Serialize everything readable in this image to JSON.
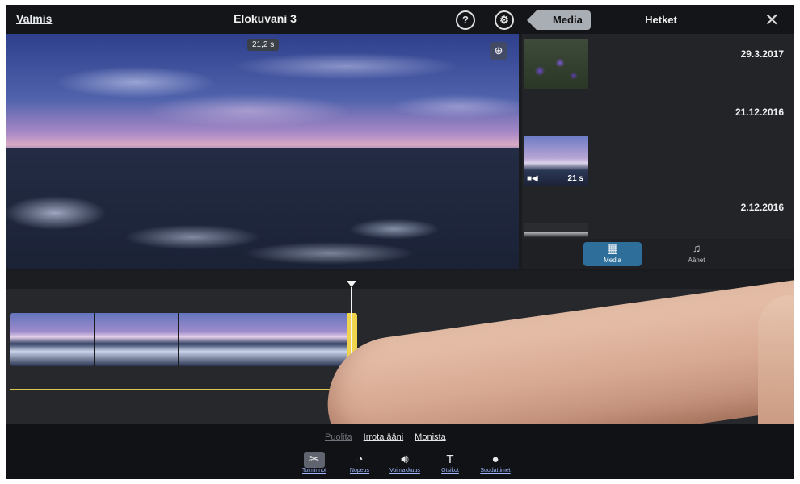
{
  "header": {
    "done_label": "Valmis",
    "project_title": "Elokuvani 3",
    "help_icon": "question-circle-icon",
    "settings_icon": "gear-circle-icon"
  },
  "preview": {
    "time_badge": "21,2 s",
    "zoom_icon": "magnify-icon"
  },
  "media_panel": {
    "back_label": "Media",
    "title": "Hetket",
    "close_icon": "close-icon",
    "moments": [
      {
        "date": "29.3.2017",
        "thumb": "flowers",
        "duration": ""
      },
      {
        "date": "21.12.2016",
        "thumb": "sky",
        "duration": "21 s"
      },
      {
        "date": "2.12.2016",
        "thumb": "dark",
        "duration": ""
      }
    ],
    "tabs": [
      {
        "label": "Media",
        "icon": "film-icon",
        "active": true
      },
      {
        "label": "Äänet",
        "icon": "music-note-icon",
        "active": false
      }
    ]
  },
  "timeline": {
    "clip_frames": 4
  },
  "actions": {
    "split": "Puolita",
    "detach_audio": "Irrota ääni",
    "duplicate": "Monista"
  },
  "tools": [
    {
      "label": "Toiminnot",
      "icon": "scissors-icon",
      "active": true
    },
    {
      "label": "Nopeus",
      "icon": "speedometer-icon",
      "active": false
    },
    {
      "label": "Voimakkuus",
      "icon": "speaker-icon",
      "active": false
    },
    {
      "label": "Otsikot",
      "icon": "text-icon",
      "active": false
    },
    {
      "label": "Suodattimet",
      "icon": "filters-icon",
      "active": false
    }
  ],
  "colors": {
    "accent_tab": "#2d6e9a",
    "clip_handle": "#f0d34d",
    "toolbar_link": "#9fb7ff"
  }
}
